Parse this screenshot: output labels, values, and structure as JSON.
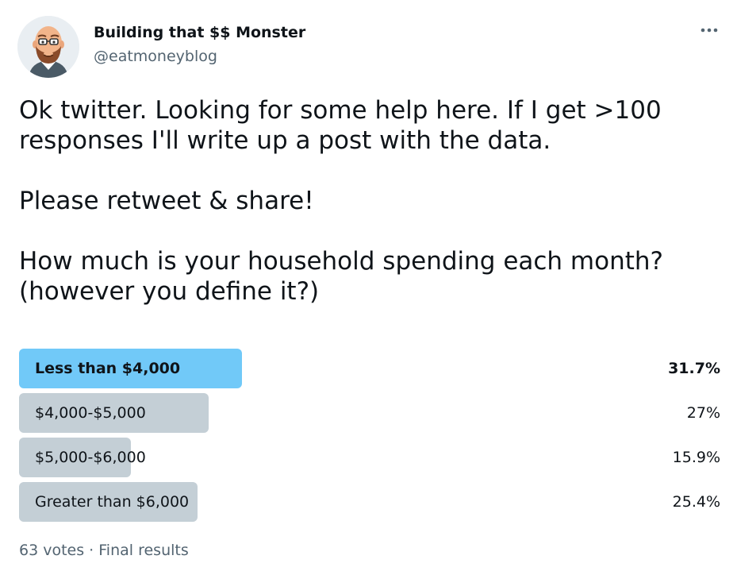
{
  "author": {
    "name": "Building that $$ Monster",
    "handle": "@eatmoneyblog",
    "avatar_icon": "bearded-man-avatar-icon"
  },
  "menu_icon": "more-horizontal-icon",
  "tweet_text": {
    "p1_line1": "Ok twitter. Looking for some help here. If I get >100",
    "p1_line2": "responses I'll write up a post with the data.",
    "p2": "Please retweet & share!",
    "p3_line1": "How much is your household spending each month?",
    "p3_line2": "(however you define it?)"
  },
  "poll": {
    "options": [
      {
        "label": "Less than $4,000",
        "percent_label": "31.7%",
        "percent": 31.7,
        "leading": true
      },
      {
        "label": "$4,000-$5,000",
        "percent_label": "27%",
        "percent": 27,
        "leading": false
      },
      {
        "label": "$5,000-$6,000",
        "percent_label": "15.9%",
        "percent": 15.9,
        "leading": false
      },
      {
        "label": "Greater than $6,000",
        "percent_label": "25.4%",
        "percent": 25.4,
        "leading": false
      }
    ],
    "votes": "63 votes",
    "separator": "·",
    "status": "Final results"
  },
  "colors": {
    "leading_bar": "#71c9f8",
    "other_bar": "#c4cfd6",
    "secondary_text": "#536471"
  }
}
